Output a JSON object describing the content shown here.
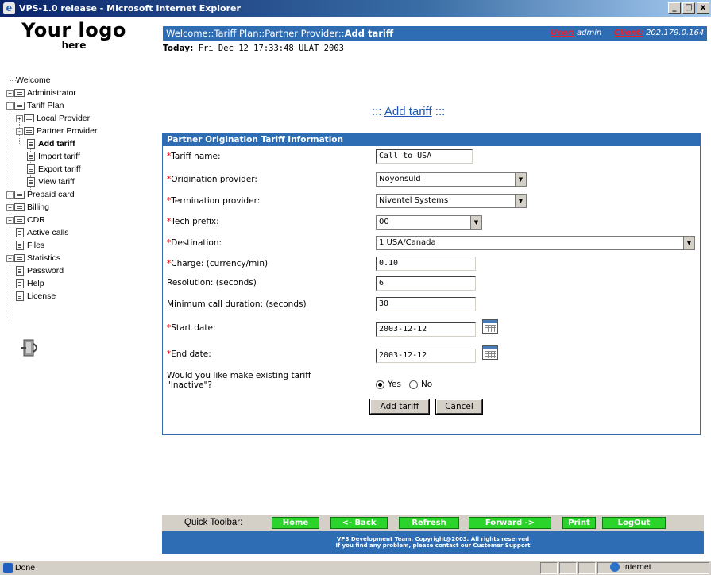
{
  "window": {
    "title": "VPS-1.0 release - Microsoft Internet Explorer",
    "buttons": [
      "_",
      "□",
      "x"
    ]
  },
  "logo": {
    "line1": "Your logo",
    "line2": "here"
  },
  "tree": [
    {
      "label": "Welcome",
      "type": "link",
      "level": 0
    },
    {
      "label": "Administrator",
      "type": "folder",
      "toggle": "+",
      "level": 0
    },
    {
      "label": "Tariff Plan",
      "type": "folder",
      "toggle": "-",
      "level": 0
    },
    {
      "label": "Local Provider",
      "type": "folder",
      "toggle": "+",
      "level": 1
    },
    {
      "label": "Partner Provider",
      "type": "folder",
      "toggle": "-",
      "level": 1
    },
    {
      "label": "Add tariff",
      "type": "doc",
      "level": 2,
      "active": true
    },
    {
      "label": "Import tariff",
      "type": "doc",
      "level": 2
    },
    {
      "label": "Export tariff",
      "type": "doc",
      "level": 2
    },
    {
      "label": "View tariff",
      "type": "doc",
      "level": 2
    },
    {
      "label": "Prepaid card",
      "type": "folder",
      "toggle": "+",
      "level": 0
    },
    {
      "label": "Billing",
      "type": "folder",
      "toggle": "+",
      "level": 0
    },
    {
      "label": "CDR",
      "type": "folder",
      "toggle": "+",
      "level": 0
    },
    {
      "label": "Active calls",
      "type": "doc",
      "level": 0
    },
    {
      "label": "Files",
      "type": "doc",
      "level": 0
    },
    {
      "label": "Statistics",
      "type": "folder",
      "toggle": "+",
      "level": 0
    },
    {
      "label": "Password",
      "type": "doc",
      "level": 0
    },
    {
      "label": "Help",
      "type": "doc",
      "level": 0
    },
    {
      "label": "License",
      "type": "doc",
      "level": 0
    }
  ],
  "header": {
    "breadcrumb_prefix": "Welcome::Tariff Plan::Partner Provider::",
    "breadcrumb_current": "Add tariff",
    "user_label": "User:",
    "user_value": "admin",
    "client_label": "Client:",
    "client_value": "202.179.0.164"
  },
  "today": {
    "label": "Today:",
    "value": "Fri Dec 12 17:33:48 ULAT 2003"
  },
  "page_title": {
    "prefix": ":::",
    "link": "Add tariff",
    "suffix": ":::"
  },
  "form": {
    "heading": "Partner Origination Tariff Information",
    "required_mark": "*",
    "fields": {
      "tariff_name": {
        "label": "Tariff name:",
        "value": "Call to USA"
      },
      "origination_provider": {
        "label": "Origination provider:",
        "value": "Noyonsuld"
      },
      "termination_provider": {
        "label": "Termination provider:",
        "value": "Niventel Systems"
      },
      "tech_prefix": {
        "label": "Tech prefix:",
        "value": "00"
      },
      "destination": {
        "label": "Destination:",
        "value": "1 USA/Canada"
      },
      "charge": {
        "label": "Charge: (currency/min)",
        "value": "0.10"
      },
      "resolution": {
        "label": "Resolution: (seconds)",
        "value": "6"
      },
      "min_duration": {
        "label": "Minimum call duration: (seconds)",
        "value": "30"
      },
      "start_date": {
        "label": "Start date:",
        "value": "2003-12-12"
      },
      "end_date": {
        "label": "End date:",
        "value": "2003-12-12"
      }
    },
    "inactive_question": "Would you like make existing tariff \"Inactive\"?",
    "radio_yes": "Yes",
    "radio_no": "No",
    "selected_radio": "Yes",
    "submit_label": "Add tariff",
    "cancel_label": "Cancel"
  },
  "quick_toolbar": {
    "label": "Quick Toolbar:",
    "buttons": [
      "Home",
      "<- Back",
      "Refresh",
      "Forward ->",
      "Print",
      "LogOut"
    ]
  },
  "footer": {
    "line1": "VPS Development Team. Copyright@2003. All rights reserved",
    "line2": "If you find any problem, please contact our Customer Support"
  },
  "statusbar": {
    "status": "Done",
    "zone": "Internet"
  },
  "colors": {
    "accent_blue": "#2e6db4",
    "required_red": "#dd0000",
    "toolbar_green": "#2bd42b"
  }
}
